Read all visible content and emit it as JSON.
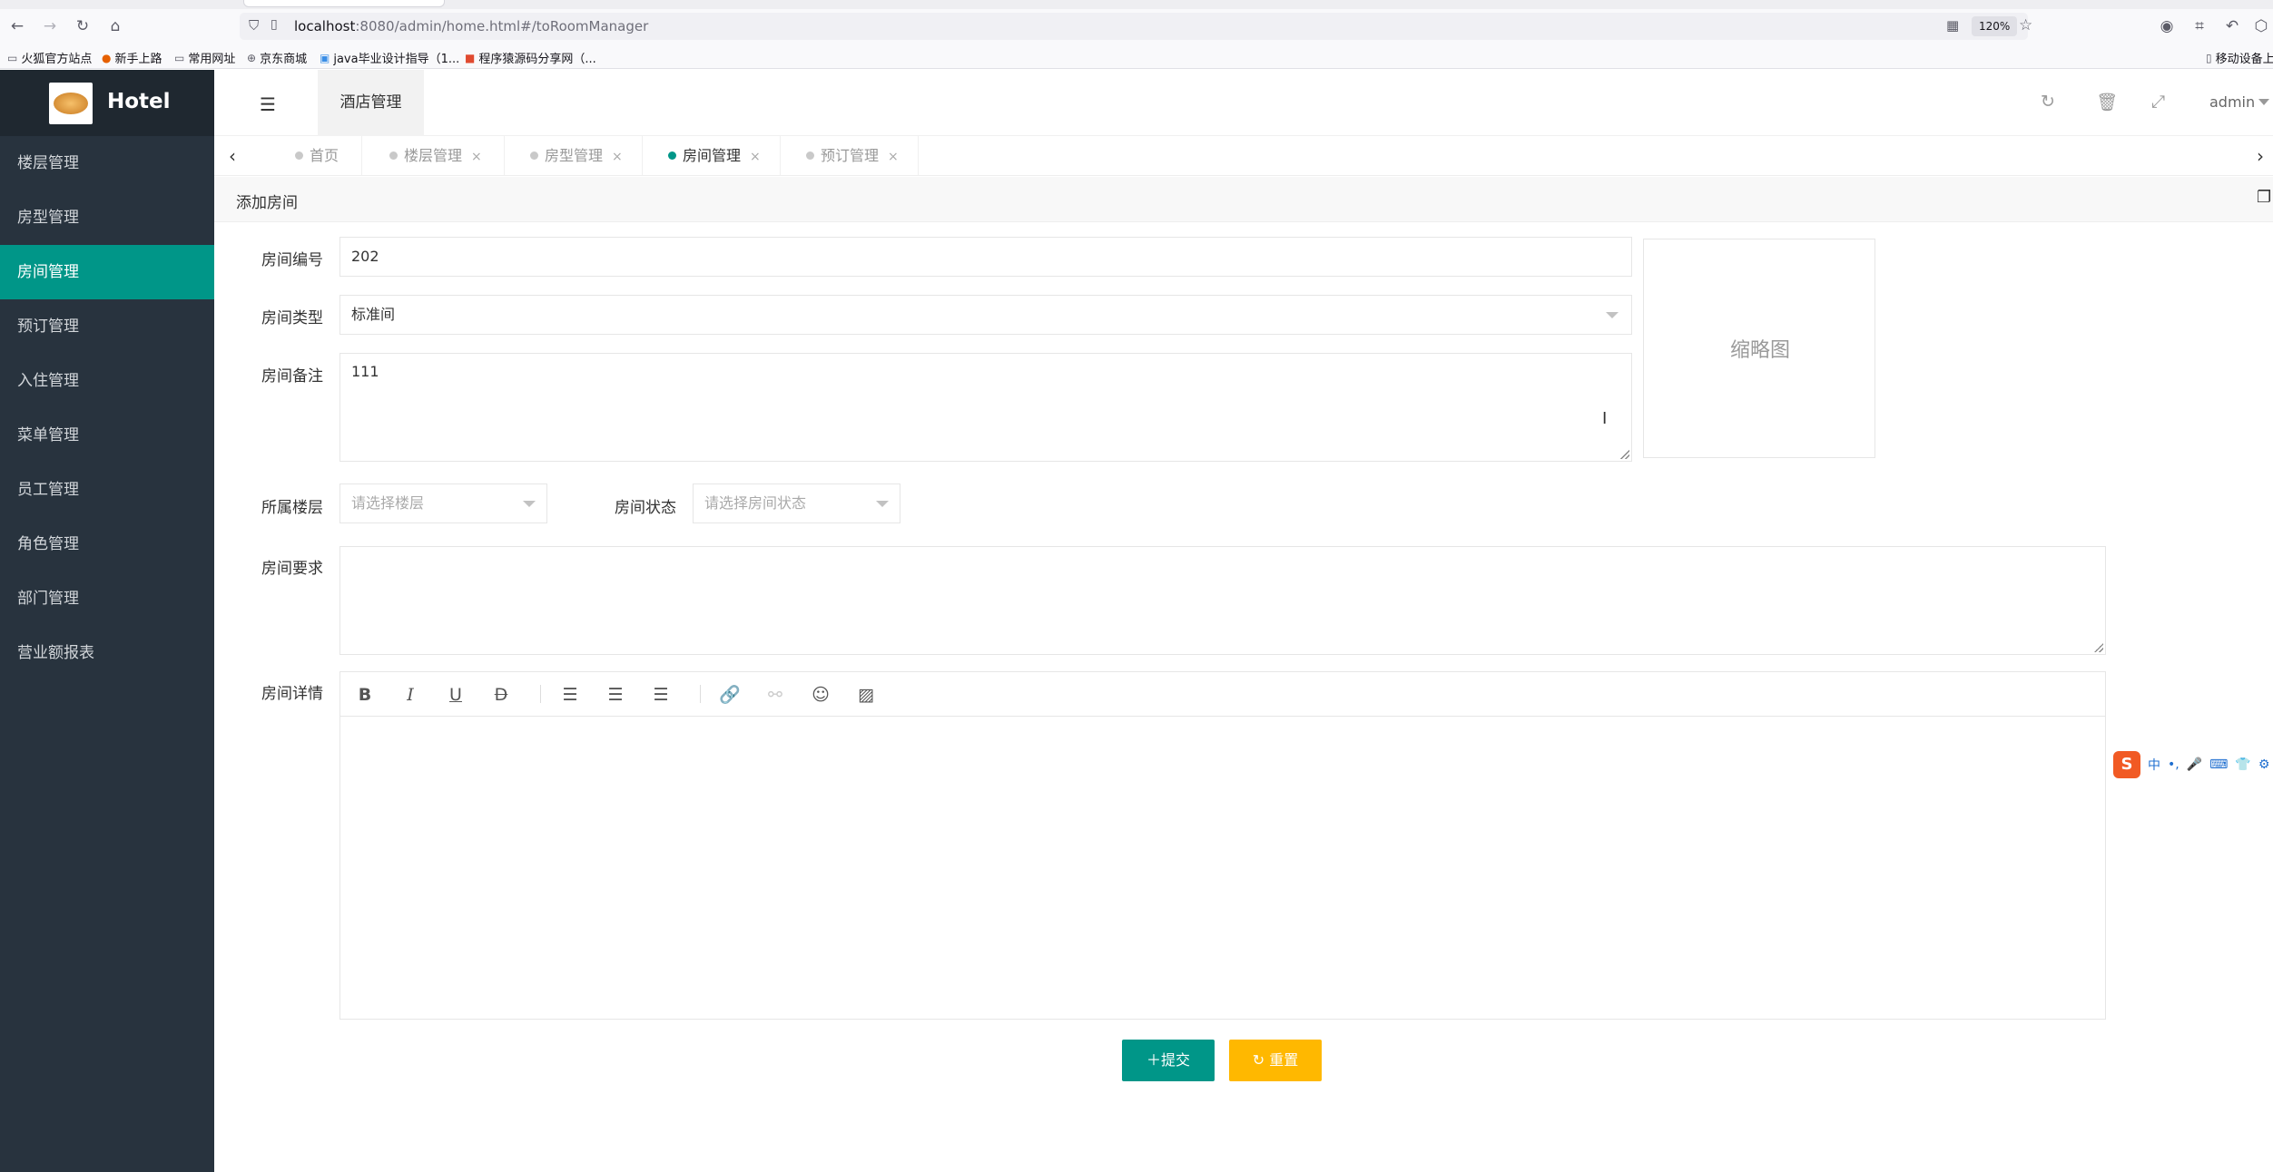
{
  "browser": {
    "url_host": "localhost",
    "url_rest": ":8080/admin/home.html#/toRoomManager",
    "zoom": "120%",
    "bookmarks": [
      "火狐官方站点",
      "新手上路",
      "常用网址",
      "京东商城",
      "java毕业设计指导（1...",
      "程序猿源码分享网（..."
    ],
    "bookmark_right": "移动设备上"
  },
  "app": {
    "logo_text": "Hotel",
    "header_tab": "酒店管理",
    "user": "admin"
  },
  "sidebar": {
    "items": [
      {
        "label": "楼层管理"
      },
      {
        "label": "房型管理"
      },
      {
        "label": "房间管理",
        "active": true
      },
      {
        "label": "预订管理"
      },
      {
        "label": "入住管理"
      },
      {
        "label": "菜单管理"
      },
      {
        "label": "员工管理"
      },
      {
        "label": "角色管理"
      },
      {
        "label": "部门管理"
      },
      {
        "label": "营业额报表"
      }
    ]
  },
  "tabs": [
    {
      "label": "首页",
      "closable": false
    },
    {
      "label": "楼层管理",
      "closable": true
    },
    {
      "label": "房型管理",
      "closable": true
    },
    {
      "label": "房间管理",
      "closable": true,
      "active": true
    },
    {
      "label": "预订管理",
      "closable": true
    }
  ],
  "form": {
    "title": "添加房间",
    "room_number": {
      "label": "房间编号",
      "value": "202"
    },
    "room_type": {
      "label": "房间类型",
      "value": "标准间"
    },
    "room_remark": {
      "label": "房间备注",
      "value": "111"
    },
    "thumbnail_label": "缩略图",
    "floor": {
      "label": "所属楼层",
      "placeholder": "请选择楼层"
    },
    "status": {
      "label": "房间状态",
      "placeholder": "请选择房间状态"
    },
    "requirement": {
      "label": "房间要求",
      "value": ""
    },
    "detail": {
      "label": "房间详情"
    },
    "submit_label": "提交",
    "reset_label": "重置"
  },
  "ime": {
    "text": "中"
  }
}
